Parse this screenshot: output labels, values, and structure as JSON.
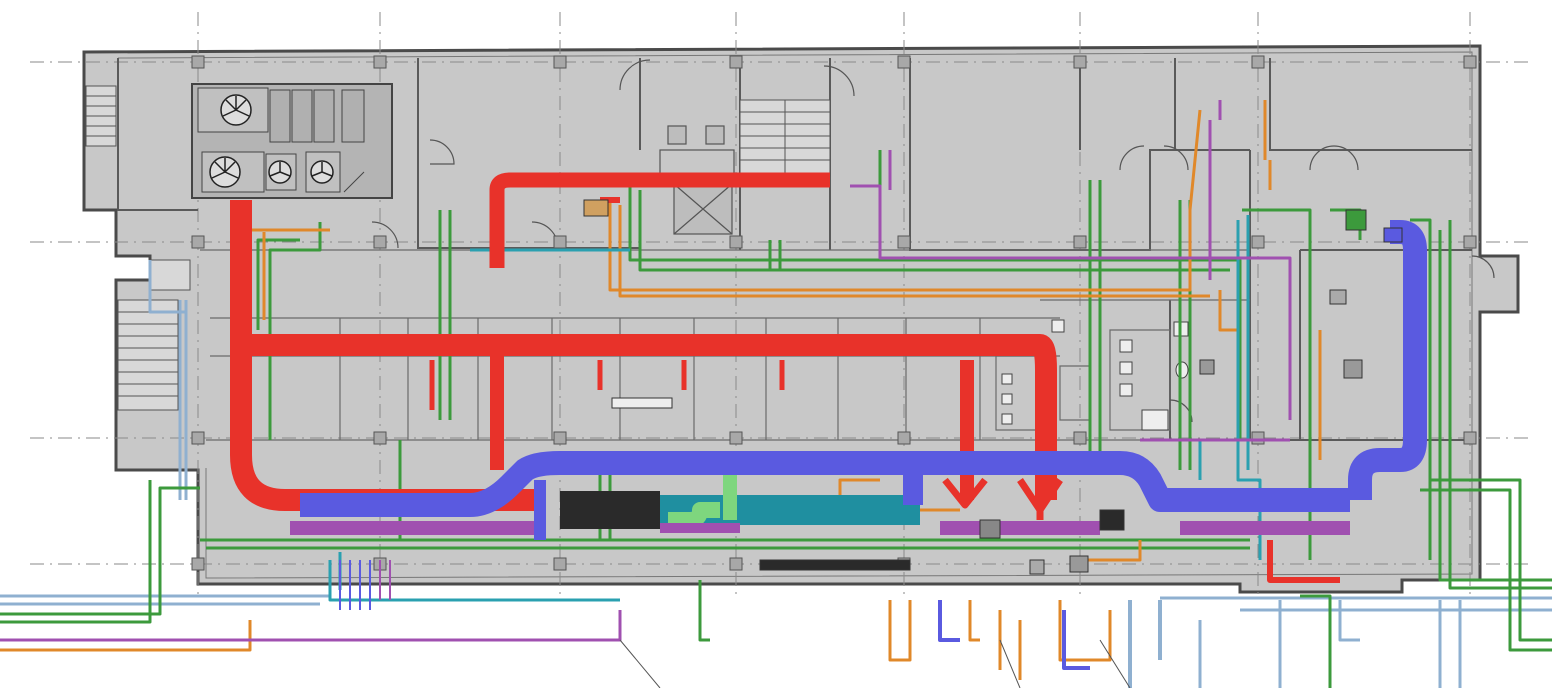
{
  "colors": {
    "background": "#ffffff",
    "floor": "#c8c8c8",
    "wall": "#5a5a5a",
    "grid": "#8a8a8a",
    "supply_duct": "#e8322a",
    "return_duct": "#5a5ae0",
    "exhaust_duct": "#a050b0",
    "chilled_water": "#3c9a3c",
    "heating_water": "#e0882a",
    "condenser_water": "#2aa0b0",
    "domestic_water": "#8fb0d0",
    "dark_equipment": "#2a2a2a",
    "teal_duct": "#1f8fa0",
    "green_duct": "#7ed67e"
  },
  "icons": [
    "fan-icon",
    "stair-icon",
    "door-swing-icon",
    "elevator-icon",
    "toilet-icon"
  ]
}
